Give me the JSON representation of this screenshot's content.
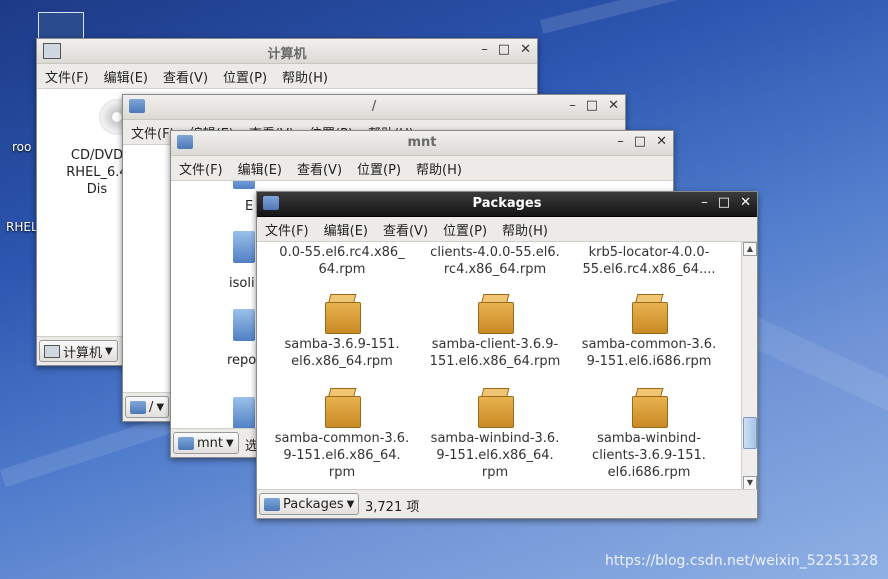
{
  "desktop": {
    "labels": [
      "roo",
      "RHEL"
    ],
    "watermark": "https://blog.csdn.net/weixin_52251328"
  },
  "menu": {
    "file": "文件(F)",
    "edit": "编辑(E)",
    "view": "查看(V)",
    "go": "位置(P)",
    "help": "帮助(H)"
  },
  "controls": {
    "minimize": "–",
    "maximize": "□",
    "close": "✕"
  },
  "win_computer": {
    "title": "计算机",
    "drive_lines": [
      "CD/DVD",
      "RHEL_6.4",
      "Dis"
    ],
    "location": "计算机"
  },
  "win_root": {
    "title": "/",
    "location": "/"
  },
  "win_mnt": {
    "title": "mnt",
    "partial_labels": [
      "E",
      "isoli",
      "repo"
    ],
    "location": "mnt",
    "status_partial": "选"
  },
  "win_packages": {
    "title": "Packages",
    "items": [
      {
        "name": "0.0-55.el6.rc4.x86_\n64.rpm"
      },
      {
        "name": "clients-4.0.0-55.el6.\nrc4.x86_64.rpm"
      },
      {
        "name": "krb5-locator-4.0.0-\n55.el6.rc4.x86_64...."
      },
      {
        "name": "samba-3.6.9-151.\nel6.x86_64.rpm"
      },
      {
        "name": "samba-client-3.6.9-\n151.el6.x86_64.rpm"
      },
      {
        "name": "samba-common-3.6.\n9-151.el6.i686.rpm"
      },
      {
        "name": "samba-common-3.6.\n9-151.el6.x86_64.\nrpm"
      },
      {
        "name": "samba-winbind-3.6.\n9-151.el6.x86_64.\nrpm"
      },
      {
        "name": "samba-winbind-\nclients-3.6.9-151.\nel6.i686.rpm"
      }
    ],
    "location": "Packages",
    "status": "3,721 项"
  }
}
